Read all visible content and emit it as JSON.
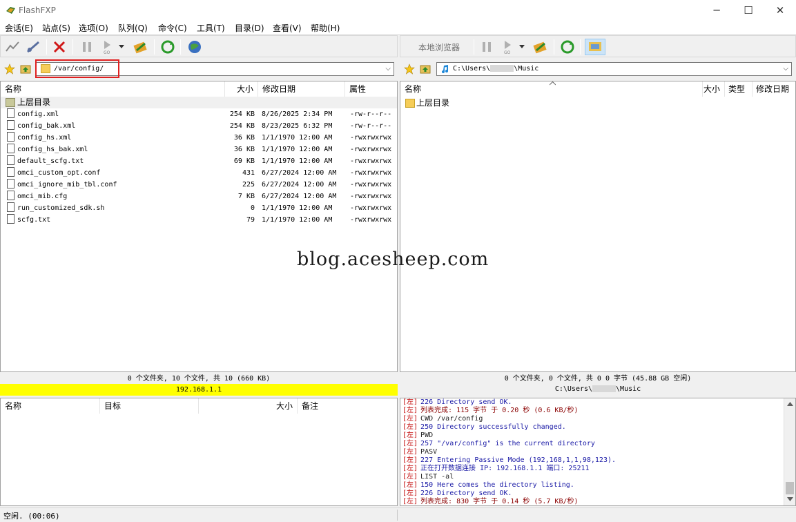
{
  "window": {
    "title": "FlashFXP",
    "controls": [
      "─",
      "☐",
      "✕"
    ]
  },
  "menu": [
    "会话(E)",
    "站点(S)",
    "选项(O)",
    "队列(Q)",
    "命令(C)",
    "工具(T)",
    "目录(D)",
    "查看(V)",
    "帮助(H)"
  ],
  "left": {
    "path": "/var/config/",
    "columns": [
      "名称",
      "大小",
      "修改日期",
      "属性"
    ],
    "parent_dir": "上层目录",
    "files": [
      {
        "name": "config.xml",
        "size": "254 KB",
        "date": "8/26/2025 2:34 PM",
        "attr": "-rw-r--r--"
      },
      {
        "name": "config_bak.xml",
        "size": "254 KB",
        "date": "8/23/2025 6:32 PM",
        "attr": "-rw-r--r--"
      },
      {
        "name": "config_hs.xml",
        "size": "36 KB",
        "date": "1/1/1970 12:00 AM",
        "attr": "-rwxrwxrwx"
      },
      {
        "name": "config_hs_bak.xml",
        "size": "36 KB",
        "date": "1/1/1970 12:00 AM",
        "attr": "-rwxrwxrwx"
      },
      {
        "name": "default_scfg.txt",
        "size": "69 KB",
        "date": "1/1/1970 12:00 AM",
        "attr": "-rwxrwxrwx"
      },
      {
        "name": "omci_custom_opt.conf",
        "size": "431",
        "date": "6/27/2024 12:00 AM",
        "attr": "-rwxrwxrwx"
      },
      {
        "name": "omci_ignore_mib_tbl.conf",
        "size": "225",
        "date": "6/27/2024 12:00 AM",
        "attr": "-rwxrwxrwx"
      },
      {
        "name": "omci_mib.cfg",
        "size": "7 KB",
        "date": "6/27/2024 12:00 AM",
        "attr": "-rwxrwxrwx"
      },
      {
        "name": "run_customized_sdk.sh",
        "size": "0",
        "date": "1/1/1970 12:00 AM",
        "attr": "-rwxrwxrwx"
      },
      {
        "name": "scfg.txt",
        "size": "79",
        "date": "1/1/1970 12:00 AM",
        "attr": "-rwxrwxrwx"
      }
    ],
    "status": "0 个文件夹, 10 个文件, 共 10 (660 KB)",
    "host": "192.168.1.1"
  },
  "right": {
    "local_browser_label": "本地浏览器",
    "path_prefix": "C:\\Users\\",
    "path_suffix": "\\Music",
    "columns": [
      "名称",
      "大小",
      "类型",
      "修改日期"
    ],
    "parent_dir": "上层目录",
    "status": "0 个文件夹, 0 个文件, 共 0 0 字节 (45.88 GB 空闲)"
  },
  "queue": {
    "columns": [
      "名称",
      "目标",
      "大小",
      "备注"
    ]
  },
  "log": [
    {
      "tag": "[左]",
      "text": "226 Directory send OK.",
      "color": "#1a1aa6"
    },
    {
      "tag": "[左]",
      "text": "列表完成: 115 字节 于 0.20 秒 (0.6 KB/秒)",
      "color": "#8b0000"
    },
    {
      "tag": "[左]",
      "text": "CWD /var/config",
      "color": "#222222"
    },
    {
      "tag": "[左]",
      "text": "250 Directory successfully changed.",
      "color": "#1a1aa6"
    },
    {
      "tag": "[左]",
      "text": "PWD",
      "color": "#222222"
    },
    {
      "tag": "[左]",
      "text": "257 \"/var/config\" is the current directory",
      "color": "#1a1aa6"
    },
    {
      "tag": "[左]",
      "text": "PASV",
      "color": "#222222"
    },
    {
      "tag": "[左]",
      "text": "227 Entering Passive Mode (192,168,1,1,98,123).",
      "color": "#1a1aa6"
    },
    {
      "tag": "[左]",
      "text": "正在打开数据连接 IP: 192.168.1.1 端口: 25211",
      "color": "#1a1aa6"
    },
    {
      "tag": "[左]",
      "text": "LIST -al",
      "color": "#222222"
    },
    {
      "tag": "[左]",
      "text": "150 Here comes the directory listing.",
      "color": "#1a1aa6"
    },
    {
      "tag": "[左]",
      "text": "226 Directory send OK.",
      "color": "#1a1aa6"
    },
    {
      "tag": "[左]",
      "text": "列表完成: 830 字节 于 0.14 秒 (5.7 KB/秒)",
      "color": "#8b0000"
    }
  ],
  "statusbar": {
    "text": "空闲. (00:06)"
  },
  "watermark": "blog.acesheep.com",
  "colors": {
    "host_bar": "#ffff00",
    "highlight": "#e02020"
  }
}
